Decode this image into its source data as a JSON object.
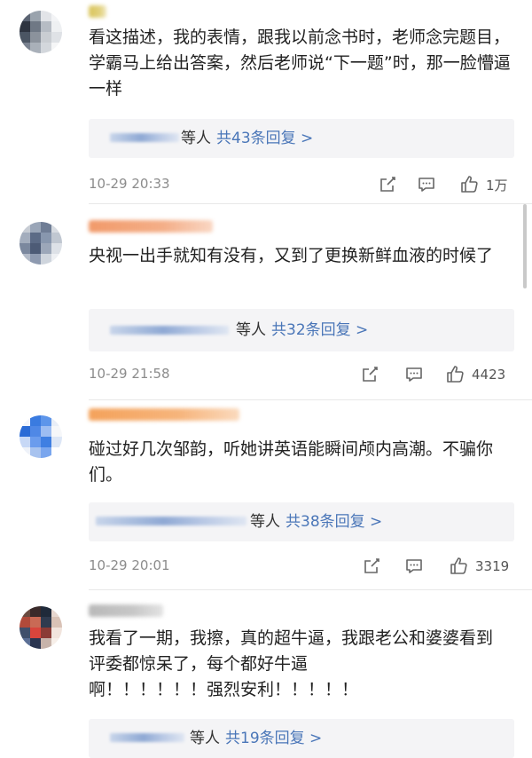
{
  "comments": [
    {
      "text": "看这描述，我的表情，跟我以前念书时，老师念完题目，学霸马上给出答案，然后老师说“下一题”时，那一脸懵逼一样",
      "reply_etc": "等人",
      "reply_count": "共43条回复 >",
      "timestamp": "10-29 20:33",
      "likes": "1万",
      "avatar_colors": [
        "#5b6473",
        "#9aa3ad",
        "#e2e4e8",
        "#f3f4f6",
        "#2e3440",
        "#6f7885",
        "#b6bcc4",
        "#eef0f2",
        "#4b5563",
        "#8b929c",
        "#c9cdd2",
        "#dfe2e6",
        "#7a8290",
        "#a9b0b9",
        "#d3d7dc",
        "#f5f6f7"
      ],
      "name_color": "#d9c45a"
    },
    {
      "text": "央视一出手就知有没有，又到了更换新鲜血液的时候了",
      "reply_etc": "等人",
      "reply_count": "共32条回复 >",
      "timestamp": "10-29 21:58",
      "likes": "4423",
      "avatar_colors": [
        "#c7ccd4",
        "#9aa6b8",
        "#6f7d95",
        "#d7dbe1",
        "#a3adbd",
        "#5c6b86",
        "#8897ae",
        "#c0c7d1",
        "#7b889e",
        "#4d5b76",
        "#9ca7b9",
        "#dde1e7",
        "#b3bbc8",
        "#8e9ab0",
        "#cfd5dd",
        "#eef0f3"
      ],
      "name_color": "#f19a6a"
    },
    {
      "text": "碰过好几次邹韵，听她讲英语能瞬间颅内高潮。不骗你们。",
      "reply_etc": "等人",
      "reply_count": "共38条回复 >",
      "timestamp": "10-29 20:01",
      "likes": "3319",
      "avatar_colors": [
        "#f2f5fb",
        "#3a7be0",
        "#5d95ea",
        "#e9eef7",
        "#2a6bd6",
        "#4f88e6",
        "#9dbdf2",
        "#f6f7f9",
        "#c7d8f6",
        "#6b9ced",
        "#3f7fe2",
        "#dce6f6",
        "#eef2f9",
        "#a8c3ef",
        "#7aa6ee",
        "#ffffff"
      ],
      "name_color": "#f4a25b"
    },
    {
      "text": "我看了一期，我擦，真的超牛逼，我跟老公和婆婆看到评委都惊呆了，每个都好牛逼\n啊！！！！！！强烈安利！！！！！",
      "reply_etc": "等人",
      "reply_count": "共19条回复 >",
      "timestamp": "",
      "likes": "",
      "avatar_colors": [
        "#6b4a3f",
        "#3a2a2a",
        "#1f2a3a",
        "#e7d7cf",
        "#b14a3a",
        "#c96a55",
        "#2f3b4f",
        "#d9c2b6",
        "#3f4f6b",
        "#d8453c",
        "#8a3b35",
        "#f1e4dd",
        "#5b6f95",
        "#2a3550",
        "#c7b3aa",
        "#f7efe9"
      ],
      "name_color": "#b9b9b9"
    }
  ],
  "icons": {
    "share": "share-icon",
    "comment": "comment-icon",
    "like": "thumbs-up-icon"
  },
  "colors": {
    "reply_count": "#4a76b8",
    "timestamp": "#8c8c8c",
    "reply_box_bg": "#f4f4f6"
  }
}
